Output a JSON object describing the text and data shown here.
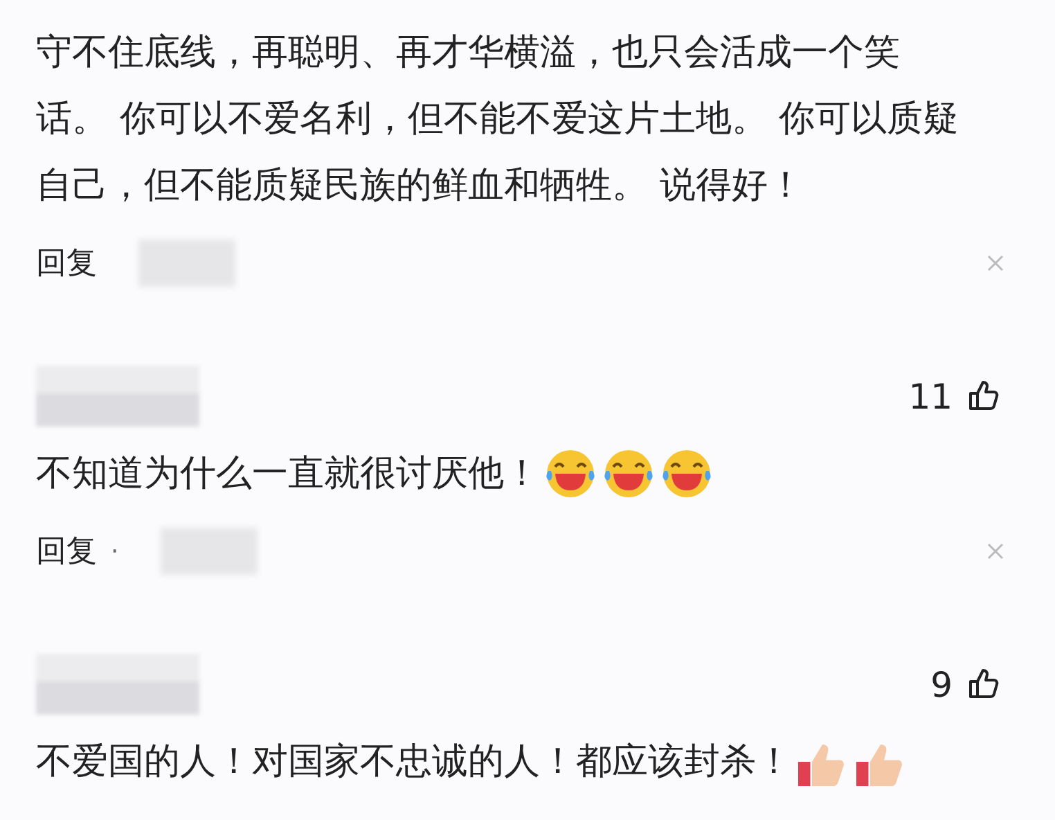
{
  "comments": [
    {
      "text": "守不住底线，再聪明、再才华横溢，也只会活成一个笑话。 你可以不爱名利，但不能不爱这片土地。 你可以质疑自己，但不能质疑民族的鲜血和牺牲。 说得好！",
      "reply": "回复"
    },
    {
      "likes": "11",
      "text": "不知道为什么一直就很讨厌他！",
      "reactions": [
        {
          "kind": "laughing"
        },
        {
          "kind": "laughing"
        },
        {
          "kind": "laughing"
        }
      ],
      "reply": "回复",
      "separator": "·"
    },
    {
      "likes": "9",
      "text": "不爱国的人！对国家不忠诚的人！都应该封杀！",
      "reactions": [
        {
          "kind": "thumbs"
        },
        {
          "kind": "thumbs"
        }
      ]
    }
  ]
}
